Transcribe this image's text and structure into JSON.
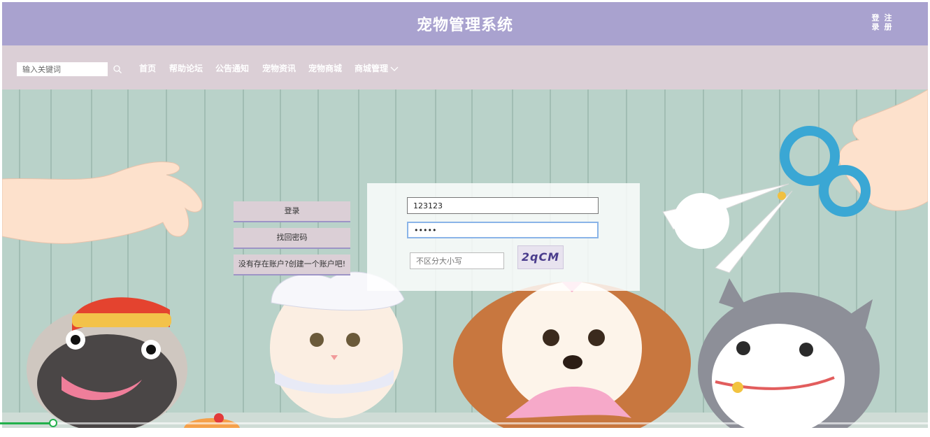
{
  "header": {
    "title": "宠物管理系统",
    "auth_chars": [
      "登",
      "注",
      "录",
      "册"
    ]
  },
  "nav": {
    "search_placeholder": "输入关键词",
    "items": [
      "首页",
      "帮助论坛",
      "公告通知",
      "宠物资讯",
      "宠物商城",
      "商城管理"
    ]
  },
  "side_buttons": {
    "login": "登录",
    "forgot": "找回密码",
    "register": "没有存在账户?创建一个账户吧!"
  },
  "login_form": {
    "username_value": "123123",
    "password_value": "•••••",
    "captcha_placeholder": "不区分大小写",
    "captcha_text": "2qCM"
  },
  "video": {
    "progress_fraction": 0.057
  },
  "colors": {
    "header": "#a9a2cf",
    "nav": "#dbcfd6",
    "accent": "#22b14c"
  }
}
